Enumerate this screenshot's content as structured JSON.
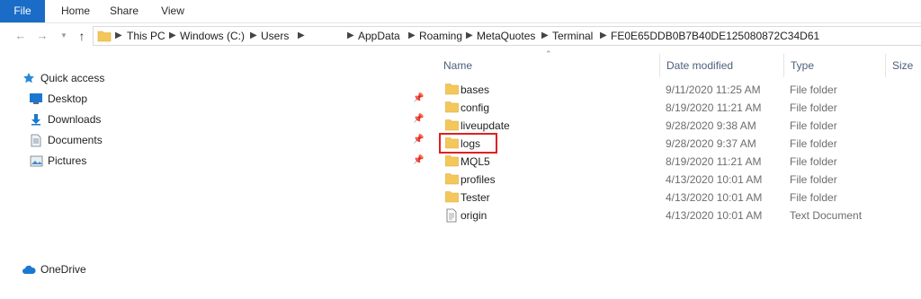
{
  "ribbon": {
    "tabs": [
      {
        "label": "File"
      },
      {
        "label": "Home"
      },
      {
        "label": "Share"
      },
      {
        "label": "View"
      }
    ]
  },
  "address_bar": {
    "crumbs": [
      "This PC",
      "Windows (C:)",
      "Users",
      "AppData",
      "Roaming",
      "MetaQuotes",
      "Terminal",
      "FE0E65DDB0B7B40DE125080872C34D61"
    ]
  },
  "nav_pane": {
    "quick_access": "Quick access",
    "items": [
      {
        "label": "Desktop",
        "icon": "desktop-icon"
      },
      {
        "label": "Downloads",
        "icon": "download-arrow-icon"
      },
      {
        "label": "Documents",
        "icon": "document-icon"
      },
      {
        "label": "Pictures",
        "icon": "pictures-icon"
      }
    ],
    "onedrive": "OneDrive"
  },
  "columns": {
    "name": "Name",
    "date_modified": "Date modified",
    "type": "Type",
    "size": "Size"
  },
  "files": [
    {
      "name": "bases",
      "date": "9/11/2020 11:25 AM",
      "type": "File folder",
      "icon": "folder-icon"
    },
    {
      "name": "config",
      "date": "8/19/2020 11:21 AM",
      "type": "File folder",
      "icon": "folder-icon"
    },
    {
      "name": "liveupdate",
      "date": "9/28/2020 9:38 AM",
      "type": "File folder",
      "icon": "folder-icon"
    },
    {
      "name": "logs",
      "date": "9/28/2020 9:37 AM",
      "type": "File folder",
      "icon": "folder-icon"
    },
    {
      "name": "MQL5",
      "date": "8/19/2020 11:21 AM",
      "type": "File folder",
      "icon": "folder-icon"
    },
    {
      "name": "profiles",
      "date": "4/13/2020 10:01 AM",
      "type": "File folder",
      "icon": "folder-icon"
    },
    {
      "name": "Tester",
      "date": "4/13/2020 10:01 AM",
      "type": "File folder",
      "icon": "folder-icon"
    },
    {
      "name": "origin",
      "date": "4/13/2020 10:01 AM",
      "type": "Text Document",
      "icon": "text-file-icon"
    }
  ],
  "colors": {
    "accent": "#1a6cc7",
    "folder": "#f3c759",
    "highlight": "#e02020"
  }
}
